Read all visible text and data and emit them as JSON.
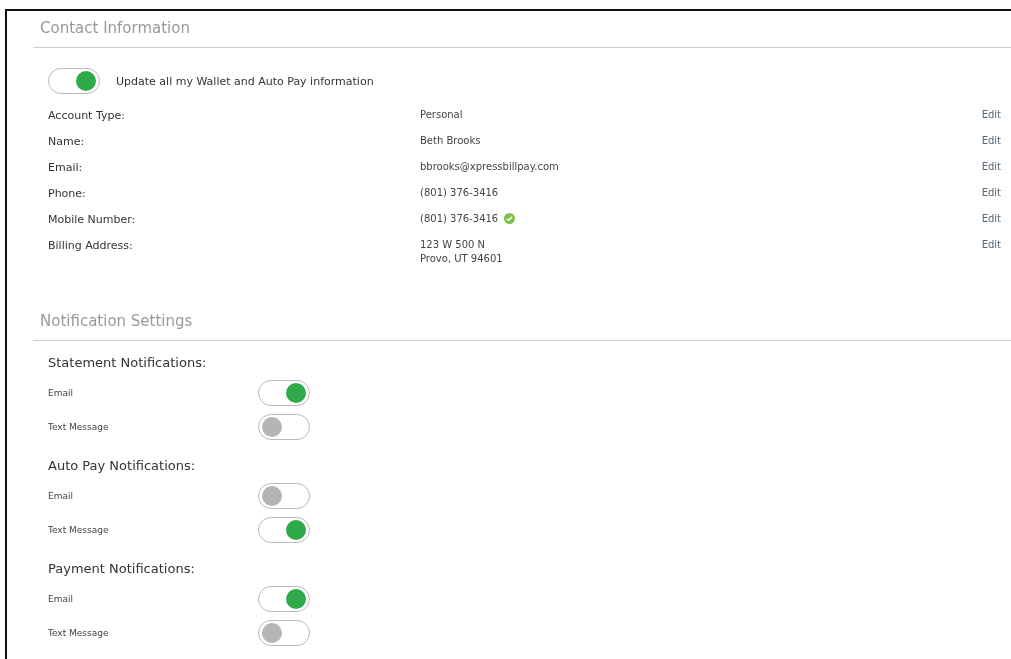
{
  "contact": {
    "title": "Contact Information",
    "update_toggle": {
      "label": "Update all my Wallet and Auto Pay information",
      "on": true
    },
    "rows": [
      {
        "label": "Account Type:",
        "value": [
          "Personal"
        ],
        "action": "Edit",
        "verified": false
      },
      {
        "label": "Name:",
        "value": [
          "Beth Brooks"
        ],
        "action": "Edit",
        "verified": false
      },
      {
        "label": "Email:",
        "value": [
          "bbrooks@xpressbillpay.com"
        ],
        "action": "Edit",
        "verified": false
      },
      {
        "label": "Phone:",
        "value": [
          "(801) 376-3416"
        ],
        "action": "Edit",
        "verified": false
      },
      {
        "label": "Mobile Number:",
        "value": [
          "(801) 376-3416"
        ],
        "action": "Edit",
        "verified": true
      },
      {
        "label": "Billing Address:",
        "value": [
          "123 W 500 N",
          "Provo, UT 94601"
        ],
        "action": "Edit",
        "verified": false
      }
    ]
  },
  "notifications": {
    "title": "Notification Settings",
    "groups": [
      {
        "title": "Statement Notifications:",
        "items": [
          {
            "label": "Email",
            "on": true
          },
          {
            "label": "Text Message",
            "on": false
          }
        ]
      },
      {
        "title": "Auto Pay Notifications:",
        "items": [
          {
            "label": "Email",
            "on": false
          },
          {
            "label": "Text Message",
            "on": true
          }
        ]
      },
      {
        "title": "Payment Notifications:",
        "items": [
          {
            "label": "Email",
            "on": true
          },
          {
            "label": "Text Message",
            "on": false
          }
        ]
      }
    ]
  }
}
